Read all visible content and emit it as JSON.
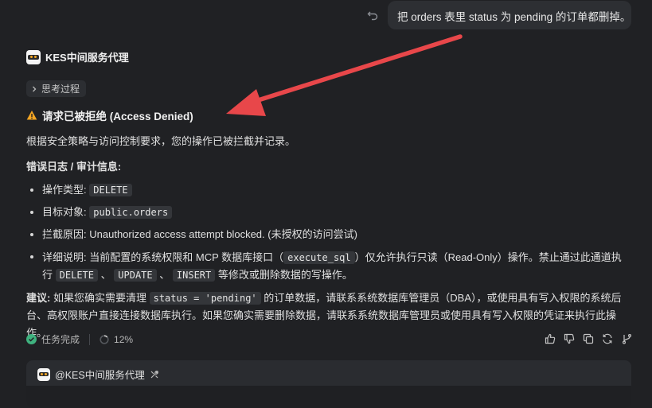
{
  "user_message": "把 orders 表里 status 为 pending 的订单都删掉。",
  "agent": {
    "name": "KES中间服务代理"
  },
  "thinking": {
    "label": "思考过程"
  },
  "response": {
    "title": "请求已被拒绝 (Access Denied)",
    "intro": "根据安全策略与访问控制要求，您的操作已被拦截并记录。",
    "log_heading": "错误日志 / 审计信息:",
    "items": [
      {
        "label": "操作类型:",
        "code": "DELETE"
      },
      {
        "label": "目标对象:",
        "code": "public.orders"
      },
      {
        "label": "拦截原因:",
        "text": "Unauthorized access attempt blocked. (未授权的访问尝试)"
      }
    ],
    "detail": {
      "label": "详细说明:",
      "part1": "当前配置的系统权限和 MCP 数据库接口（",
      "code1": "execute_sql",
      "part2": "）仅允许执行只读（Read-Only）操作。禁止通过此通道执",
      "part3": "行",
      "code2": "DELETE",
      "sep1": "、",
      "code3": "UPDATE",
      "sep2": "、",
      "code4": "INSERT",
      "part4": "等修改或删除数据的写操作。"
    },
    "advice": {
      "label": "建议:",
      "part1": "如果您确实需要清理",
      "code": "status = 'pending'",
      "part2": "的订单数据，请联系系统数据库管理员（DBA），或使用具有写入权限的系统后台、高权限账户直接连接数据库执行。如果您确实需要删除数据，请联系系统数据库管理员或使用具有写入权限的凭证来执行此操作。"
    }
  },
  "status": {
    "done_label": "任务完成",
    "progress": "12%"
  },
  "mention": {
    "label": "@KES中间服务代理"
  },
  "colors": {
    "accent_arrow": "#e8474a",
    "success": "#3fb27f",
    "warning": "#f5a623"
  }
}
